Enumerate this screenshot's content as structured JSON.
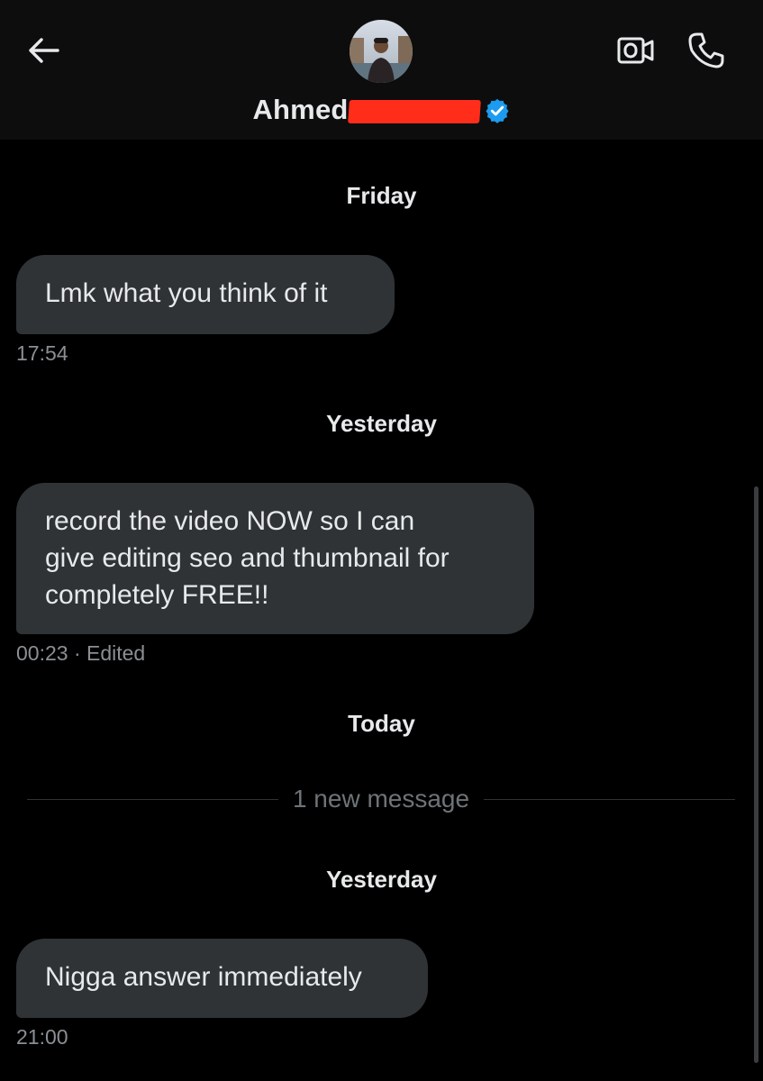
{
  "header": {
    "contact_name": "Ahmed",
    "back_icon": "arrow-left-icon",
    "video_icon": "video-camera-icon",
    "phone_icon": "phone-icon",
    "verified_icon": "verified-badge-icon",
    "verified_color": "#1d9bf0"
  },
  "conversation": {
    "sections": [
      {
        "date": "Friday",
        "message": "Lmk what you think of it",
        "time": "17:54"
      },
      {
        "date": "Yesterday",
        "message": "record the video NOW so I can\ngive editing seo and thumbnail for\ncompletely FREE!!",
        "time": "00:23 · Edited"
      },
      {
        "date": "Today",
        "new_message_label": "1 new message"
      },
      {
        "date": "Yesterday",
        "message": "Nigga answer immediately",
        "time": "21:00"
      }
    ]
  }
}
